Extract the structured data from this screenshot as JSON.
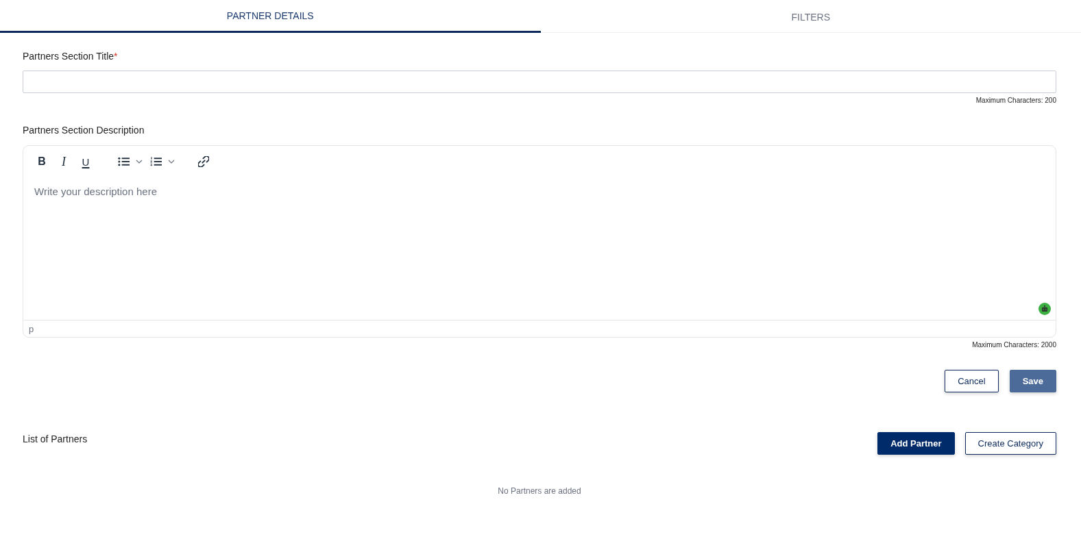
{
  "tabs": [
    {
      "label": "PARTNER DETAILS",
      "selected": true
    },
    {
      "label": "FILTERS",
      "selected": false
    }
  ],
  "title_field": {
    "label": "Partners Section Title",
    "required_mark": "*",
    "hint": "Maximum Characters: 200"
  },
  "description_field": {
    "label": "Partners Section Description",
    "toolbar": [
      {
        "kind": "bold",
        "label": "B",
        "dropdown": false
      },
      {
        "kind": "italic",
        "label": "I",
        "dropdown": false
      },
      {
        "kind": "underline",
        "label": "U",
        "dropdown": false
      },
      {
        "kind": "bullet-list",
        "dropdown": true
      },
      {
        "kind": "numbered-list",
        "dropdown": true
      },
      {
        "kind": "link",
        "dropdown": false
      }
    ],
    "placeholder": "Write your description here",
    "path": "p",
    "hint": "Maximum Characters: 2000"
  },
  "form_buttons": [
    {
      "label": "Cancel",
      "kind": "outline",
      "disabled": false
    },
    {
      "label": "Save",
      "kind": "primary",
      "disabled": true
    }
  ],
  "partners": {
    "title": "List of Partners",
    "buttons": [
      {
        "label": "Add Partner",
        "kind": "primary",
        "disabled": false
      },
      {
        "label": "Create Category",
        "kind": "outline",
        "disabled": false
      }
    ],
    "empty_message": "No Partners are added"
  }
}
